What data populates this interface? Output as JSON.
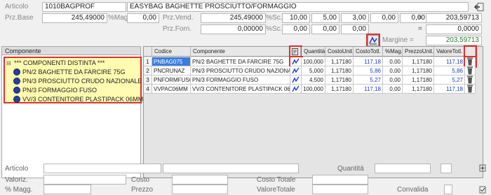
{
  "header": {
    "articolo_label": "Articolo",
    "articolo_code": "1010BAGPROF",
    "articolo_desc": "EASYBAG BAGHETTE PROSCIUTTO/FORMAGGIO",
    "prz_base_label": "Prz.Base",
    "prz_base_value": "245,49000",
    "mag_label": "%Mag",
    "mag_value": "0,00",
    "prz_vend_label": "Prz.Vend.",
    "prz_vend_value": "245,49000",
    "sc_label_1": "%Sc.",
    "sc1": "10,00",
    "sc2": "5,00",
    "sc3": "3,00",
    "sc4": "0,00",
    "sc5": "0,00",
    "eq1": "=",
    "total_vend": "203,59713",
    "prz_forn_label": "Prz.Forn.",
    "prz_forn_value": "0,00000",
    "sc_label_2": "%Sc.",
    "f_sc1": "0,00",
    "f_sc2": "0,00",
    "f_sc3": "0,00",
    "eq2": "=",
    "total_forn": "0,0000",
    "margine_label": "Margine =",
    "margine_value": "203,59713"
  },
  "tree": {
    "title": "Componente",
    "root": "*** COMPONENTI DISTINTA ***",
    "items": [
      "PN/2 BAGHETTE DA FARCIRE 75G",
      "PN/3 PROSCIUTTO CRUDO NAZIONALE",
      "PN/3 FORMAGGIO FUSO",
      "VV/3 CONTENITORE PLASTIPACK 06MM"
    ]
  },
  "grid": {
    "columns": [
      "Codice",
      "Componente",
      "Quantità",
      "CostoUnit.",
      "CostoTotl.",
      "%Mag.",
      "PrezzoUnit.",
      "ValoreTotl."
    ],
    "rows": [
      {
        "n": "1",
        "codice": "PNBAG075",
        "componente": "PN/2 BAGHETTE DA FARCIRE 75G",
        "qta": "100,000",
        "cu": "1,17180",
        "ct": "117,18",
        "mag": "0,00",
        "pu": "1,17180",
        "vt": "117,18"
      },
      {
        "n": "2",
        "codice": "PNCRUNAZ",
        "componente": "PN/3 PROSCIUTTO CRUDO NAZIONALE",
        "qta": "5,000",
        "cu": "1,17180",
        "ct": "5,86",
        "mag": "0,00",
        "pu": "1,17180",
        "vt": "5,86"
      },
      {
        "n": "3",
        "codice": "PNFORMFUSO",
        "componente": "PN/3 FORMAGGIO FUSO",
        "qta": "4,500",
        "cu": "1,17180",
        "ct": "5,27",
        "mag": "0,00",
        "pu": "1,17180",
        "vt": "5,27"
      },
      {
        "n": "4",
        "codice": "VVPAC06MM",
        "componente": "VV/3 CONTENITORE PLASTIPACK 06MM",
        "qta": "100,000",
        "cu": "1,17180",
        "ct": "117,18",
        "mag": "0,00",
        "pu": "1,17180",
        "vt": "117,18"
      }
    ]
  },
  "footer": {
    "articolo_label": "Articolo",
    "quantita_label": "Quantità",
    "valoriz_label": "Valoriz.",
    "costo_label": "Costo",
    "costo_totale_label": "Costo Totale",
    "magg_label": "% Magg.",
    "prezzo_label": "Prezzo",
    "valore_totale_label": "ValoreTotale",
    "convalida_label": "Convalida"
  },
  "colors": {
    "highlight": "#e03030",
    "selection": "#3b7ddd",
    "tree_bg": "#fffbb0",
    "link_blue": "#1a3ed0",
    "margin_green": "#2a7a2a"
  }
}
